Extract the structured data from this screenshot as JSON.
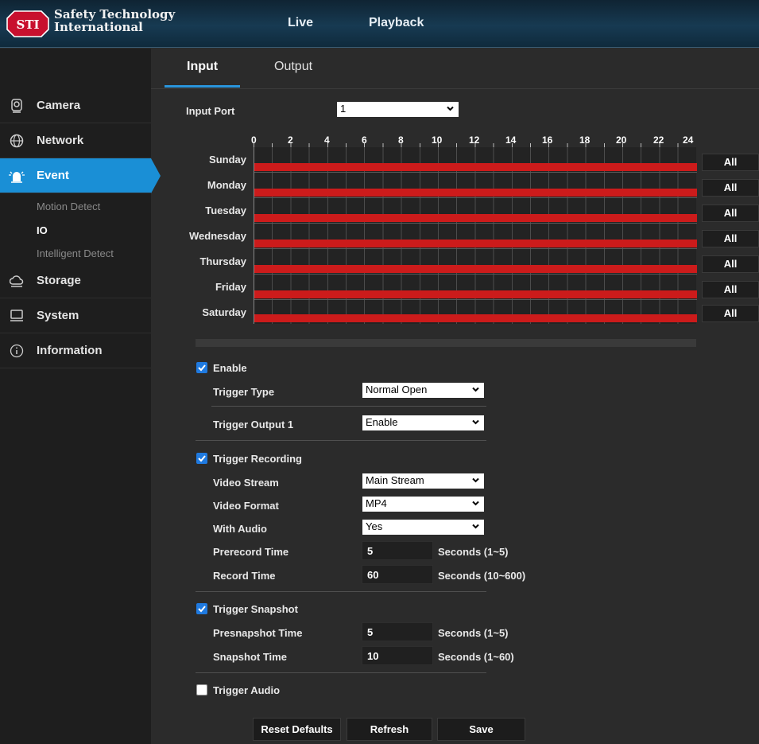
{
  "header": {
    "brand_line1": "Safety Technology",
    "brand_line2": "International",
    "logo_text": "STI",
    "nav": [
      "Live",
      "Playback"
    ]
  },
  "sidebar": {
    "items": [
      {
        "label": "Camera",
        "icon": "camera-icon"
      },
      {
        "label": "Network",
        "icon": "globe-icon"
      },
      {
        "label": "Event",
        "icon": "alarm-icon"
      },
      {
        "label": "Storage",
        "icon": "cloud-icon"
      },
      {
        "label": "System",
        "icon": "monitor-icon"
      },
      {
        "label": "Information",
        "icon": "info-icon"
      }
    ],
    "event_subitems": [
      "Motion Detect",
      "IO",
      "Intelligent Detect"
    ],
    "active_item": "Event",
    "active_subitem": "IO"
  },
  "tabs": {
    "input": "Input",
    "output": "Output",
    "active": "Input"
  },
  "input_port": {
    "label": "Input Port",
    "value": "1"
  },
  "schedule": {
    "hours": [
      "0",
      "2",
      "4",
      "6",
      "8",
      "10",
      "12",
      "14",
      "16",
      "18",
      "20",
      "22",
      "24"
    ],
    "days": [
      "Sunday",
      "Monday",
      "Tuesday",
      "Wednesday",
      "Thursday",
      "Friday",
      "Saturday"
    ],
    "all_label": "All"
  },
  "enable": {
    "label": "Enable",
    "checked": true
  },
  "trigger_type": {
    "label": "Trigger Type",
    "value": "Normal Open"
  },
  "trigger_output": {
    "label": "Trigger Output 1",
    "value": "Enable"
  },
  "trigger_recording": {
    "label": "Trigger Recording",
    "checked": true,
    "video_stream": {
      "label": "Video Stream",
      "value": "Main Stream"
    },
    "video_format": {
      "label": "Video Format",
      "value": "MP4"
    },
    "with_audio": {
      "label": "With Audio",
      "value": "Yes"
    },
    "prerecord": {
      "label": "Prerecord Time",
      "value": "5",
      "unit": "Seconds (1~5)"
    },
    "record": {
      "label": "Record Time",
      "value": "60",
      "unit": "Seconds (10~600)"
    }
  },
  "trigger_snapshot": {
    "label": "Trigger Snapshot",
    "checked": true,
    "presnapshot": {
      "label": "Presnapshot Time",
      "value": "5",
      "unit": "Seconds (1~5)"
    },
    "snapshot": {
      "label": "Snapshot Time",
      "value": "10",
      "unit": "Seconds (1~60)"
    }
  },
  "trigger_audio": {
    "label": "Trigger Audio",
    "checked": false
  },
  "buttons": {
    "reset": "Reset Defaults",
    "refresh": "Refresh",
    "save": "Save"
  },
  "colors": {
    "accent": "#1a8fd6",
    "schedule_bar": "#cc1b1b",
    "checkbox": "#1f7ae0"
  }
}
